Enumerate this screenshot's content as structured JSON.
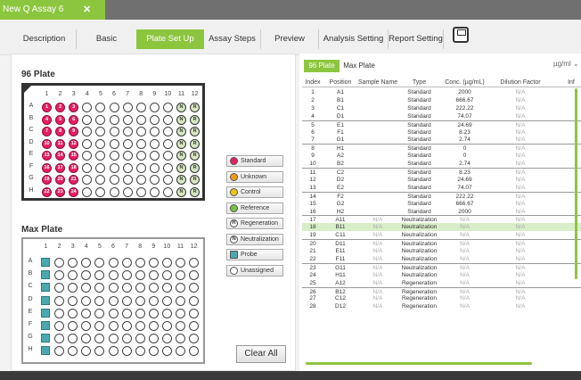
{
  "window": {
    "tab_title": "New Q Assay 6",
    "close_icon": "close-icon"
  },
  "nav": {
    "items": [
      "Description",
      "Basic Parameters",
      "Plate Set Up",
      "Assay Steps",
      "Preview",
      "Analysis Setting",
      "Report Setting"
    ],
    "active": "Plate Set Up",
    "save_icon": "save-icon"
  },
  "plate96": {
    "title": "96 Plate",
    "columns": [
      "1",
      "2",
      "3",
      "4",
      "5",
      "6",
      "7",
      "8",
      "9",
      "10",
      "11",
      "12"
    ],
    "rows": [
      "A",
      "B",
      "C",
      "D",
      "E",
      "F",
      "G",
      "H"
    ],
    "standard_markers": {
      "A": [
        "1",
        "2",
        "3"
      ],
      "B": [
        "4",
        "5",
        "6"
      ],
      "C": [
        "7",
        "8",
        "9"
      ],
      "D": [
        "10",
        "11",
        "12"
      ],
      "E": [
        "13",
        "14",
        "15"
      ],
      "F": [
        "16",
        "17",
        "18"
      ],
      "G": [
        "19",
        "20",
        "21"
      ],
      "H": [
        "22",
        "23",
        "24"
      ]
    },
    "neutralization_label": "N",
    "regeneration_label": "R"
  },
  "max_plate": {
    "title": "Max Plate",
    "columns": [
      "1",
      "2",
      "3",
      "4",
      "5",
      "6",
      "7",
      "8",
      "9",
      "10",
      "11",
      "12"
    ],
    "rows": [
      "A",
      "B",
      "C",
      "D",
      "E",
      "F",
      "G",
      "H"
    ]
  },
  "legend": [
    {
      "label": "Standard",
      "color": "#e91e63",
      "symbol": ""
    },
    {
      "label": "Unknown",
      "color": "#f39c12",
      "symbol": ""
    },
    {
      "label": "Control",
      "color": "#f1c40f",
      "symbol": ""
    },
    {
      "label": "Reference",
      "color": "#7ac143",
      "symbol": ""
    },
    {
      "label": "Regeneration",
      "color": "#ffffff",
      "symbol": "R"
    },
    {
      "label": "Neutralization",
      "color": "#ffffff",
      "symbol": "N"
    },
    {
      "label": "Probe",
      "color": "#4aa8b0",
      "symbol": ""
    },
    {
      "label": "Unassigned",
      "color": "#ffffff",
      "symbol": ""
    }
  ],
  "clear_button": "Clear All",
  "right_tabs": [
    "96 Plate",
    "Max Plate"
  ],
  "unit": "µg/ml",
  "table": {
    "headers": [
      "Index",
      "Position",
      "Sample Name",
      "Type",
      "Conc. (µg/mL)",
      "Dilution Factor",
      "Inf"
    ],
    "rows": [
      [
        "1",
        "A1",
        "",
        "Standard",
        "2000",
        "N/A"
      ],
      [
        "2",
        "B1",
        "",
        "Standard",
        "666.67",
        "N/A"
      ],
      [
        "3",
        "C1",
        "",
        "Standard",
        "222.22",
        "N/A"
      ],
      [
        "4",
        "D1",
        "",
        "Standard",
        "74.07",
        "N/A"
      ],
      [
        "5",
        "E1",
        "",
        "Standard",
        "24.69",
        "N/A"
      ],
      [
        "6",
        "F1",
        "",
        "Standard",
        "8.23",
        "N/A"
      ],
      [
        "7",
        "G1",
        "",
        "Standard",
        "2.74",
        "N/A"
      ],
      [
        "8",
        "H1",
        "",
        "Standard",
        "0",
        "N/A"
      ],
      [
        "9",
        "A2",
        "",
        "Standard",
        "0",
        "N/A"
      ],
      [
        "10",
        "B2",
        "",
        "Standard",
        "2.74",
        "N/A"
      ],
      [
        "11",
        "C2",
        "",
        "Standard",
        "8.23",
        "N/A"
      ],
      [
        "12",
        "D2",
        "",
        "Standard",
        "24.69",
        "N/A"
      ],
      [
        "13",
        "E2",
        "",
        "Standard",
        "74.07",
        "N/A"
      ],
      [
        "14",
        "F2",
        "",
        "Standard",
        "222.22",
        "N/A"
      ],
      [
        "15",
        "G2",
        "",
        "Standard",
        "666.67",
        "N/A"
      ],
      [
        "16",
        "H2",
        "",
        "Standard",
        "2000",
        "N/A"
      ],
      [
        "17",
        "A11",
        "N/A",
        "Neutralization",
        "N/A",
        "N/A"
      ],
      [
        "18",
        "B11",
        "N/A",
        "Neutralization",
        "N/A",
        "N/A"
      ],
      [
        "19",
        "C11",
        "N/A",
        "Neutralization",
        "N/A",
        "N/A"
      ],
      [
        "20",
        "D11",
        "N/A",
        "Neutralization",
        "N/A",
        "N/A"
      ],
      [
        "21",
        "E11",
        "N/A",
        "Neutralization",
        "N/A",
        "N/A"
      ],
      [
        "22",
        "F11",
        "N/A",
        "Neutralization",
        "N/A",
        "N/A"
      ],
      [
        "23",
        "G11",
        "N/A",
        "Neutralization",
        "N/A",
        "N/A"
      ],
      [
        "24",
        "H11",
        "N/A",
        "Neutralization",
        "N/A",
        "N/A"
      ],
      [
        "25",
        "A12",
        "N/A",
        "Regeneration",
        "N/A",
        "N/A"
      ],
      [
        "26",
        "B12",
        "N/A",
        "Regeneration",
        "N/A",
        "N/A"
      ],
      [
        "27",
        "C12",
        "N/A",
        "Regeneration",
        "N/A",
        "N/A"
      ],
      [
        "28",
        "D12",
        "N/A",
        "Regeneration",
        "N/A",
        "N/A"
      ]
    ],
    "highlighted_index": "18"
  },
  "colors": {
    "accent": "#8cc63f",
    "standard": "#e91e63",
    "highlight_row": "#d8eec8",
    "probe": "#4aa8b0"
  }
}
